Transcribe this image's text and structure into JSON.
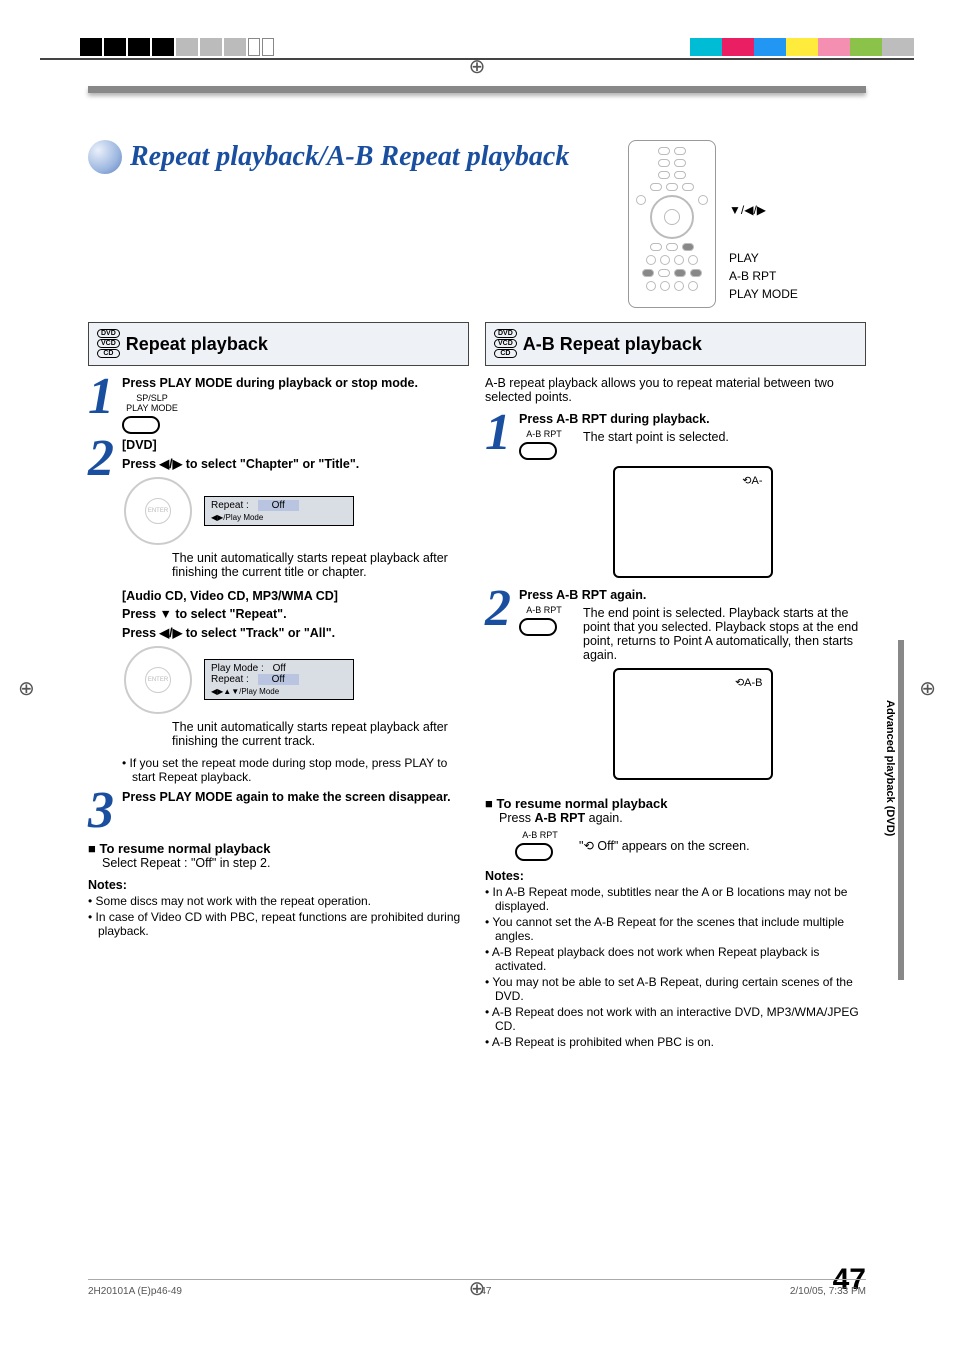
{
  "page_title": "Repeat playback/A-B Repeat playback",
  "remote_labels": {
    "dir": "▼/◀/▶",
    "play": "PLAY",
    "abrpt": "A-B RPT",
    "playmode": "PLAY MODE"
  },
  "disc_badge": {
    "dvd": "DVD",
    "vcd": "VCD",
    "cd": "CD"
  },
  "left": {
    "heading": "Repeat playback",
    "step1": {
      "head": "Press PLAY MODE during playback or stop mode.",
      "btn_l1": "SP/SLP",
      "btn_l2": "PLAY MODE"
    },
    "step2": {
      "dvd": "[DVD]",
      "head1": "Press ◀/▶ to select \"Chapter\" or \"Title\".",
      "osd1_l1": "Repeat",
      "osd1_v1": "Off",
      "osd1_foot": "◀▶/Play Mode",
      "p1": "The unit automatically starts repeat playback after finishing the current title or chapter.",
      "cd": "[Audio CD, Video CD, MP3/WMA CD]",
      "head2a": "Press ▼ to select \"Repeat\".",
      "head2b": "Press ◀/▶ to select \"Track\" or \"All\".",
      "osd2_l1": "Play Mode",
      "osd2_v1": "Off",
      "osd2_l2": "Repeat",
      "osd2_v2": "Off",
      "osd2_foot": "◀▶▲▼/Play Mode",
      "p2": "The unit automatically starts repeat playback after finishing the current track.",
      "bullet": "If you set the repeat mode during stop mode, press PLAY to start Repeat playback."
    },
    "step3": {
      "head": "Press PLAY MODE again to make the screen disappear."
    },
    "resume_hd": "To resume normal playback",
    "resume_body": "Select Repeat : \"Off\" in step 2.",
    "notes_hd": "Notes:",
    "notes": [
      "Some discs may not work with the repeat operation.",
      "In case of Video CD with PBC, repeat functions are prohibited during playback."
    ]
  },
  "right": {
    "heading": "A-B Repeat playback",
    "intro": "A-B repeat playback allows you to repeat material between two selected points.",
    "step1": {
      "head": "Press A-B RPT during playback.",
      "btn": "A-B RPT",
      "p": "The start point is selected.",
      "osd": "⟲A-"
    },
    "step2": {
      "head": "Press A-B RPT again.",
      "btn": "A-B RPT",
      "p": "The end point is selected. Playback starts at the point that you selected. Playback stops at the end point, returns to Point A automatically, then starts again.",
      "osd": "⟲A-B"
    },
    "resume_hd": "To resume normal playback",
    "resume_body_pre": "Press ",
    "resume_body_b": "A-B RPT",
    "resume_body_post": " again.",
    "off_btn": "A-B RPT",
    "off_msg_pre": "\"",
    "off_icon": "⟲ Off",
    "off_msg_post": "\" appears on the screen.",
    "notes_hd": "Notes:",
    "notes": [
      "In A-B Repeat mode, subtitles near the A or B locations may not be displayed.",
      "You cannot set the A-B Repeat for the scenes that include multiple angles.",
      "A-B Repeat playback does not work when Repeat playback is activated.",
      "You may not be able to set A-B Repeat, during certain scenes of the DVD.",
      "A-B Repeat does not work with an interactive DVD, MP3/WMA/JPEG CD.",
      "A-B Repeat is prohibited when PBC is on."
    ]
  },
  "side_tab": "Advanced playback (DVD)",
  "page_number": "47",
  "footer": {
    "left": "2H20101A (E)p46-49",
    "mid": "47",
    "right": "2/10/05, 7:33 PM"
  }
}
